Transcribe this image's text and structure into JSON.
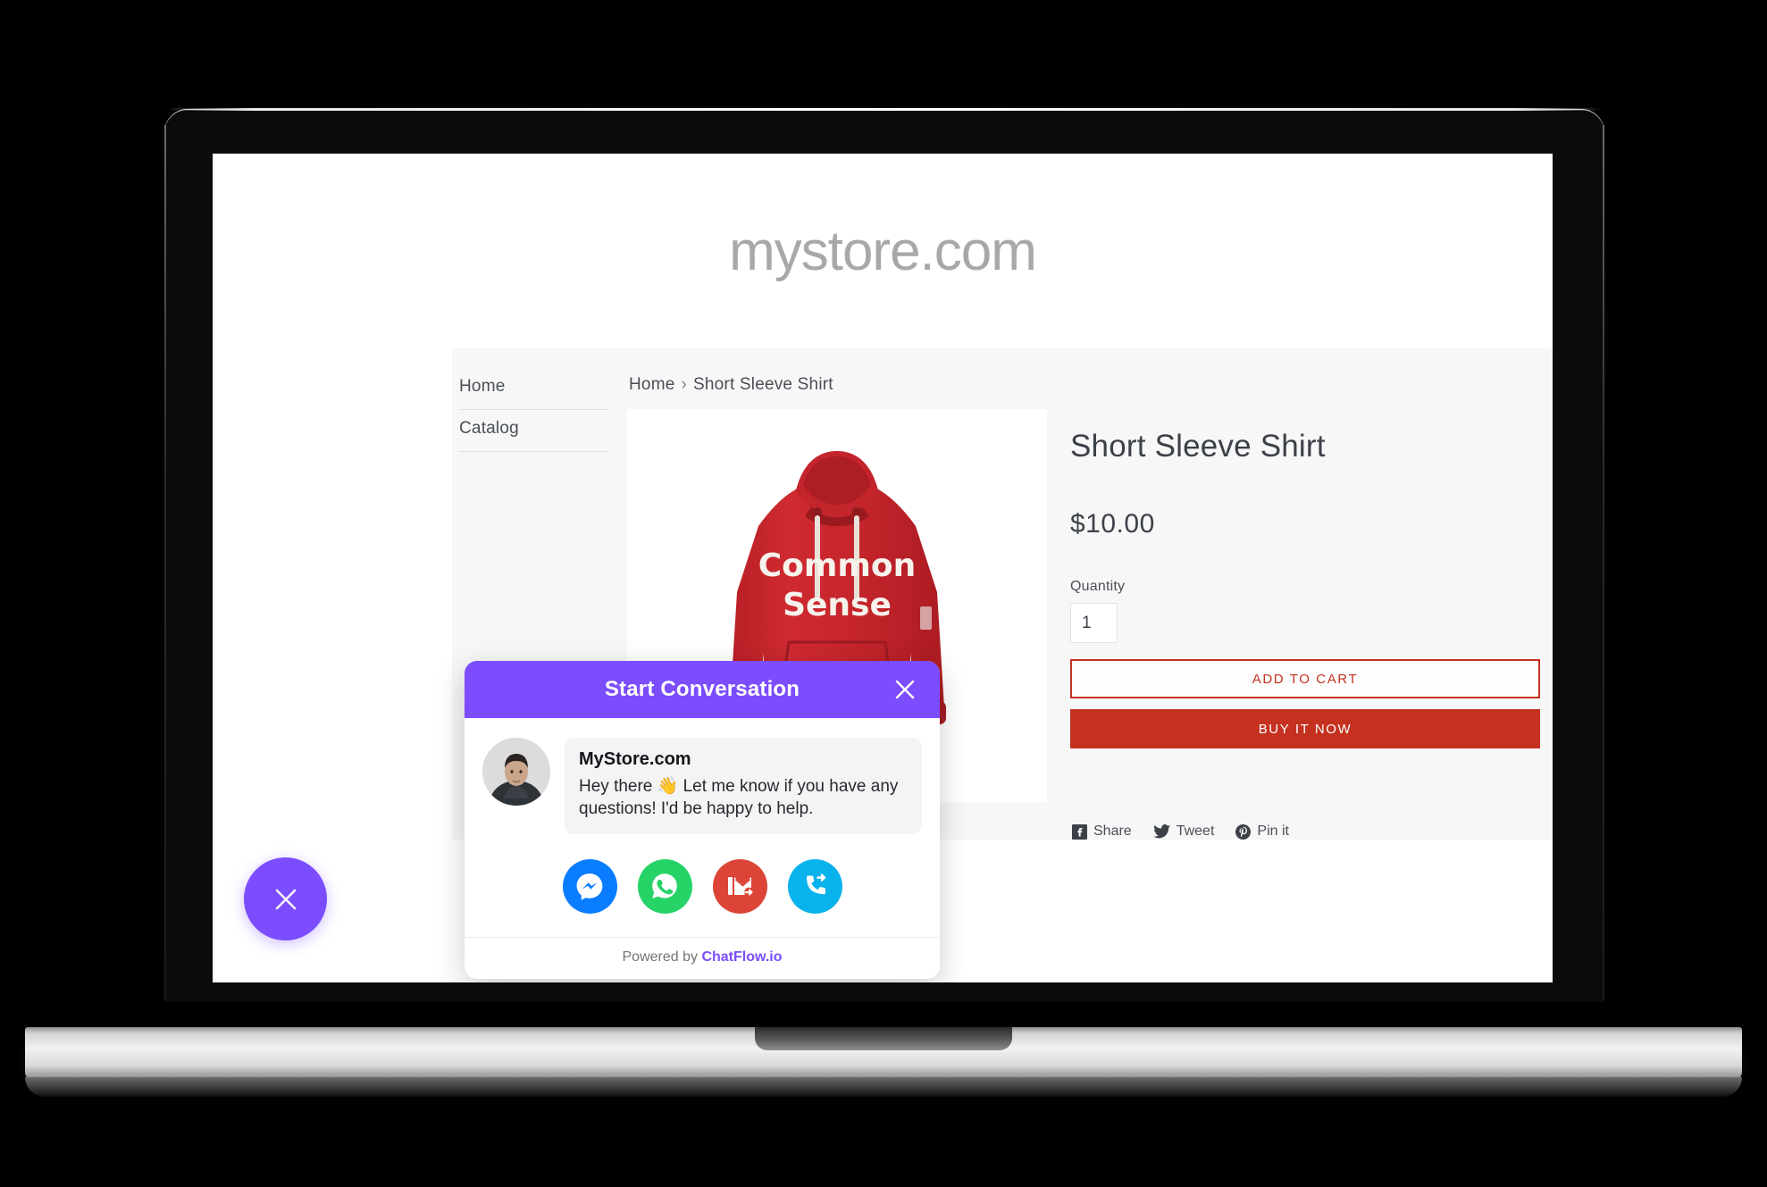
{
  "device": {
    "type": "laptop-mockup"
  },
  "store": {
    "logo": "mystore.com",
    "sidebar": {
      "items": [
        {
          "label": "Home"
        },
        {
          "label": "Catalog"
        }
      ]
    },
    "breadcrumb": {
      "home": "Home",
      "separator": "›",
      "current": "Short Sleeve Shirt"
    },
    "product": {
      "title": "Short Sleeve Shirt",
      "price": "$10.00",
      "quantity_label": "Quantity",
      "quantity_value": "1",
      "add_to_cart_label": "ADD TO CART",
      "buy_now_label": "BUY IT NOW",
      "image": {
        "alt": "Red pullover hoodie",
        "graphic_line1": "Common",
        "graphic_line2": "Sense",
        "color": "#c8242c"
      }
    },
    "social": [
      {
        "label": "Share",
        "icon": "facebook-icon"
      },
      {
        "label": "Tweet",
        "icon": "twitter-icon"
      },
      {
        "label": "Pin it",
        "icon": "pinterest-icon"
      }
    ]
  },
  "chat_widget": {
    "header_title": "Start Conversation",
    "header_color": "#7c4dfc",
    "close_icon": "close-icon",
    "agent": {
      "name": "MyStore.com",
      "avatar_alt": "Agent avatar photo"
    },
    "message": "Hey there 👋 Let me know if you have any questions! I'd be happy to help.",
    "channels": [
      {
        "name": "Messenger",
        "icon": "messenger-icon",
        "color": "#0a7cff"
      },
      {
        "name": "WhatsApp",
        "icon": "whatsapp-icon",
        "color": "#25d366"
      },
      {
        "name": "Email",
        "icon": "email-forward-icon",
        "color": "#db4437"
      },
      {
        "name": "Phone",
        "icon": "phone-forward-icon",
        "color": "#08b2ec"
      }
    ],
    "footer": {
      "prefix": "Powered by ",
      "brand": "ChatFlow.io"
    },
    "fab": {
      "icon": "close-icon",
      "color": "#7c4dfc"
    }
  }
}
